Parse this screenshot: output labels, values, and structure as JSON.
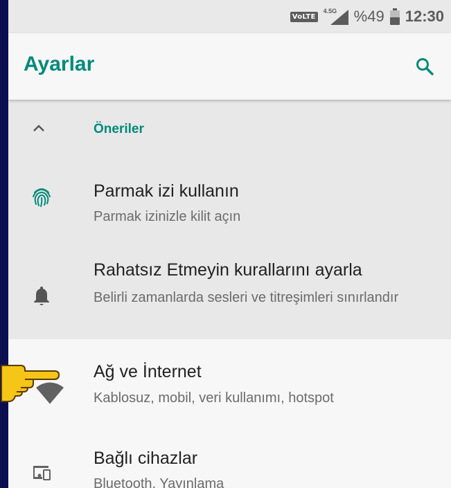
{
  "status_bar": {
    "volte": "VoLTE",
    "network_gen": "4.5G",
    "battery": "%49",
    "time": "12:30"
  },
  "app_bar": {
    "title": "Ayarlar",
    "search_icon": "search-icon"
  },
  "suggestions": {
    "header": "Öneriler",
    "items": [
      {
        "title": "Parmak izi kullanın",
        "subtitle": "Parmak izinizle kilit açın",
        "icon": "fingerprint-icon"
      },
      {
        "title": "Rahatsız Etmeyin kurallarını ayarla",
        "subtitle": "Belirli zamanlarda sesleri ve titreşimleri sınırlandır",
        "icon": "bell-icon"
      }
    ]
  },
  "settings": {
    "items": [
      {
        "title": "Ağ ve İnternet",
        "subtitle": "Kablosuz, mobil, veri kullanımı, hotspot",
        "icon": "wifi-icon"
      },
      {
        "title": "Bağlı cihazlar",
        "subtitle": "Bluetooth, Yayınlama",
        "icon": "devices-icon"
      }
    ]
  },
  "colors": {
    "accent": "#00897b",
    "page_background": "#0b0f52"
  }
}
